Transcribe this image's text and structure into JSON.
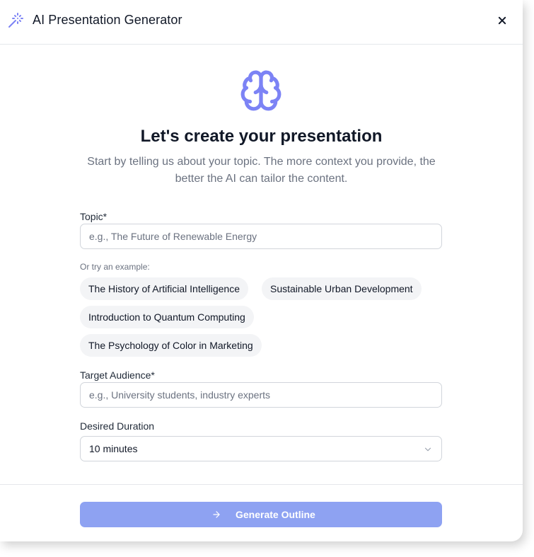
{
  "header": {
    "title": "AI Presentation Generator",
    "icon": "magic-wand-icon",
    "close_icon": "close-icon"
  },
  "hero": {
    "icon": "brain-icon",
    "heading": "Let's create your presentation",
    "subtext": "Start by telling us about your topic. The more context you provide, the better the AI can tailor the content."
  },
  "topic": {
    "label": "Topic*",
    "placeholder": "e.g., The Future of Renewable Energy",
    "value": ""
  },
  "examples": {
    "label": "Or try an example:",
    "items": [
      "The History of Artificial Intelligence",
      "Sustainable Urban Development",
      "Introduction to Quantum Computing",
      "The Psychology of Color in Marketing"
    ]
  },
  "audience": {
    "label": "Target Audience*",
    "placeholder": "e.g., University students, industry experts",
    "value": ""
  },
  "duration": {
    "label": "Desired Duration",
    "selected": "10 minutes"
  },
  "footer": {
    "generate_label": "Generate Outline",
    "generate_icon": "arrow-right-icon"
  },
  "colors": {
    "accent": "#7c83f5",
    "button_disabled": "#8ea2f2",
    "chip_bg": "#f3f4f6",
    "border": "#d1d5db",
    "muted_text": "#6b7280"
  }
}
